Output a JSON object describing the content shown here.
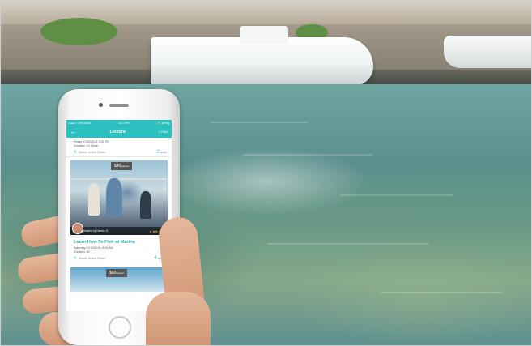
{
  "app": {
    "status": {
      "carrier": "●●●○○ VERIZON",
      "time": "4:21 PM",
      "battery": "⚡ 33% ▮"
    },
    "nav": {
      "back": "←",
      "title": "Leisure",
      "filter": "+ Filter"
    },
    "previous_listing": {
      "datetime": "Friday 07/02/2015, 5:00 PM",
      "duration": "Duration: 1h 30min",
      "location": "Miami, United States",
      "spots_number": "2",
      "spots_label": "spots"
    },
    "listing": {
      "price": "$40",
      "price_unit": "/person",
      "host": "Hosted by Dennis S.",
      "rating_stars": "★★★★☆",
      "title": "Learn How To Fish at Marina",
      "datetime": "Saturday 07/10/2015, 8:00 AM",
      "duration": "Duration: 8h",
      "location": "Miami, United States",
      "spots_number": "4",
      "spots_label": "spots"
    },
    "next_listing": {
      "price": "$60",
      "price_unit": "/person"
    }
  }
}
